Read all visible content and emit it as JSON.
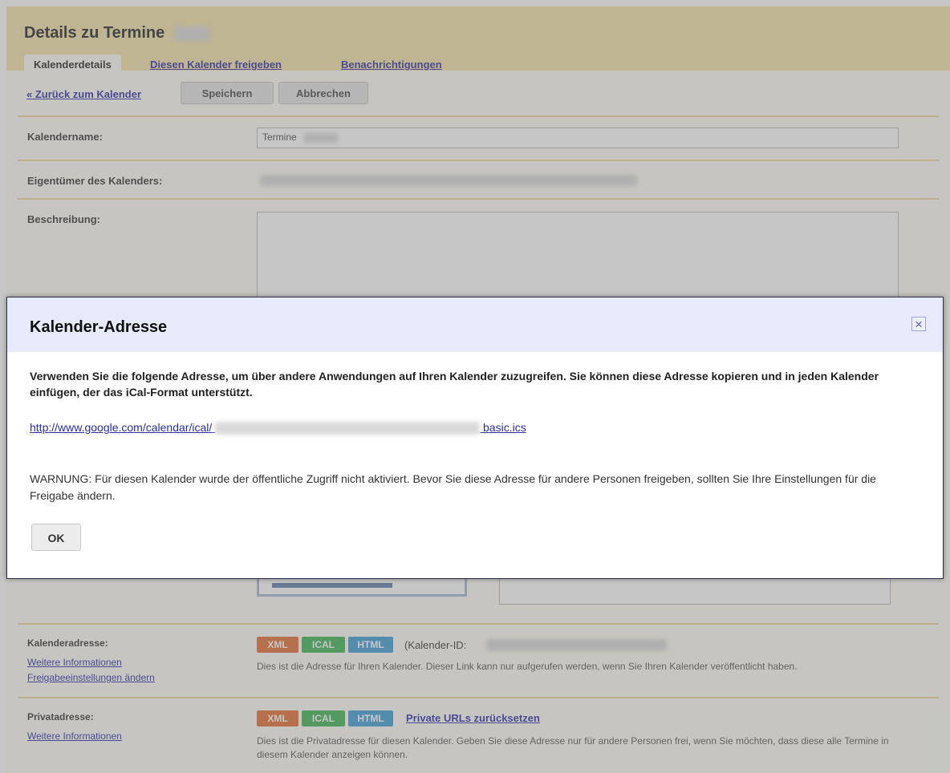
{
  "header": {
    "title": "Details zu Termine"
  },
  "tabs": [
    {
      "label": "Kalenderdetails"
    },
    {
      "label": "Diesen Kalender freigeben"
    },
    {
      "label": "Benachrichtigungen"
    }
  ],
  "toolbar": {
    "back_label": "« Zurück zum Kalender",
    "save_label": "Speichern",
    "cancel_label": "Abbrechen"
  },
  "form": {
    "name_label": "Kalendername:",
    "name_value": "Termine",
    "owner_label": "Eigentümer des Kalenders:",
    "description_label": "Beschreibung:"
  },
  "calendar_address": {
    "label": "Kalenderadresse:",
    "more_info": "Weitere Informationen",
    "change_sharing": "Freigabeeinstellungen ändern",
    "badges": [
      "XML",
      "ICAL",
      "HTML"
    ],
    "calendar_id_label": "(Kalender-ID:",
    "description": "Dies ist die Adresse für Ihren Kalender. Dieser Link kann nur aufgerufen werden, wenn Sie Ihren Kalender veröffentlicht haben."
  },
  "private_address": {
    "label": "Privatadresse:",
    "more_info": "Weitere Informationen",
    "badges": [
      "XML",
      "ICAL",
      "HTML"
    ],
    "reset_link": "Private URLs zurücksetzen",
    "description": "Dies ist die Privatadresse für diesen Kalender. Geben Sie diese Adresse nur für andere Personen frei, wenn Sie möchten, dass diese alle Termine in diesem Kalender anzeigen können."
  },
  "dialog": {
    "title": "Kalender-Adresse",
    "close_icon": "close-icon",
    "intro": "Verwenden Sie die folgende Adresse, um über andere Anwendungen auf Ihren Kalender zuzugreifen. Sie können diese Adresse kopieren und in jeden Kalender einfügen, der das iCal-Format unterstützt.",
    "url_prefix": "http://www.google.com/calendar/ical/",
    "url_suffix": "basic.ics",
    "warning": "WARNUNG: Für diesen Kalender wurde der öffentliche Zugriff nicht aktiviert. Bevor Sie diese Adresse für andere Personen freigeben, sollten Sie Ihre Einstellungen für die Freigabe ändern.",
    "ok_label": "OK"
  },
  "colors": {
    "header_bg": "#f3e2a6",
    "link": "#2c2ca8",
    "xml_badge": "#e46c2c",
    "ical_badge": "#3bb24f",
    "html_badge": "#3b9bd6",
    "dialog_header": "#e6eafb"
  }
}
